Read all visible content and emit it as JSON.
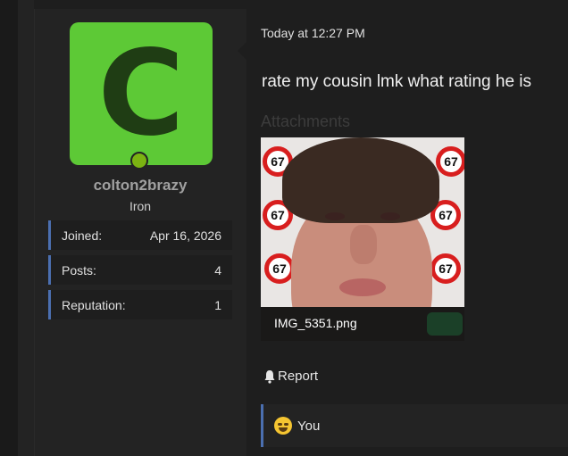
{
  "user": {
    "avatar_letter": "C",
    "avatar_color": "#5dc936",
    "online_indicator_color": "#7bb312",
    "username": "colton2brazy",
    "rank": "Iron",
    "stats": [
      {
        "label": "Joined:",
        "value": "Apr 16, 2026"
      },
      {
        "label": "Posts:",
        "value": "4"
      },
      {
        "label": "Reputation:",
        "value": "1"
      }
    ]
  },
  "post": {
    "date": "Today at 12:27 PM",
    "body": "rate my cousin lmk what rating he is",
    "attachments_title": "Attachments",
    "attachment": {
      "filename": "IMG_5351.png",
      "sign_number": "67"
    },
    "report_label": "Report",
    "report_icon": "bell-icon",
    "reaction": {
      "icon": "laughing-crying-emoji-icon",
      "label": "You"
    }
  },
  "colors": {
    "accent_border": "#4b6fb0",
    "background": "#1c1c1c",
    "panel": "#232323"
  }
}
